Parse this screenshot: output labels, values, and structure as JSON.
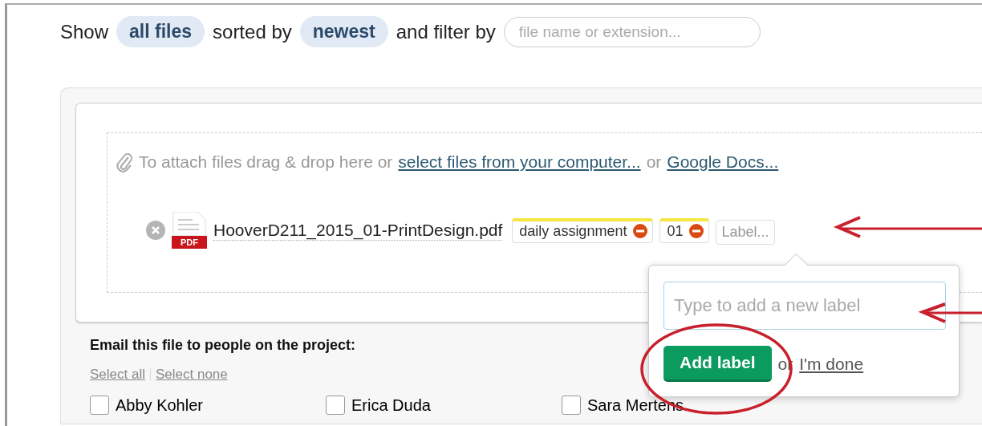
{
  "filter_bar": {
    "show_label": "Show",
    "show_value": "all files",
    "sorted_label": "sorted by",
    "sort_value": "newest",
    "filter_label": "and filter by",
    "filter_placeholder": "file name or extension..."
  },
  "attach": {
    "prompt": "To attach files drag & drop here or",
    "computer_link": "select files from your computer...",
    "or": "or",
    "docs_link": "Google Docs..."
  },
  "file": {
    "name": "HooverD211_2015_01-PrintDesign.pdf",
    "type_badge": "PDF",
    "labels": [
      {
        "text": "daily assignment"
      },
      {
        "text": "01"
      }
    ],
    "label_button": "Label..."
  },
  "label_popover": {
    "placeholder": "Type to add a new label",
    "add_button": "Add label",
    "or": "or",
    "done_link": "I'm done"
  },
  "email": {
    "heading": "Email this file to people on the project:",
    "select_all": "Select all",
    "select_none": "Select none",
    "people": [
      {
        "name": "Abby Kohler",
        "checked": false
      },
      {
        "name": "Erica Duda",
        "checked": false
      },
      {
        "name": "Sara Mertens",
        "checked": false
      }
    ]
  }
}
